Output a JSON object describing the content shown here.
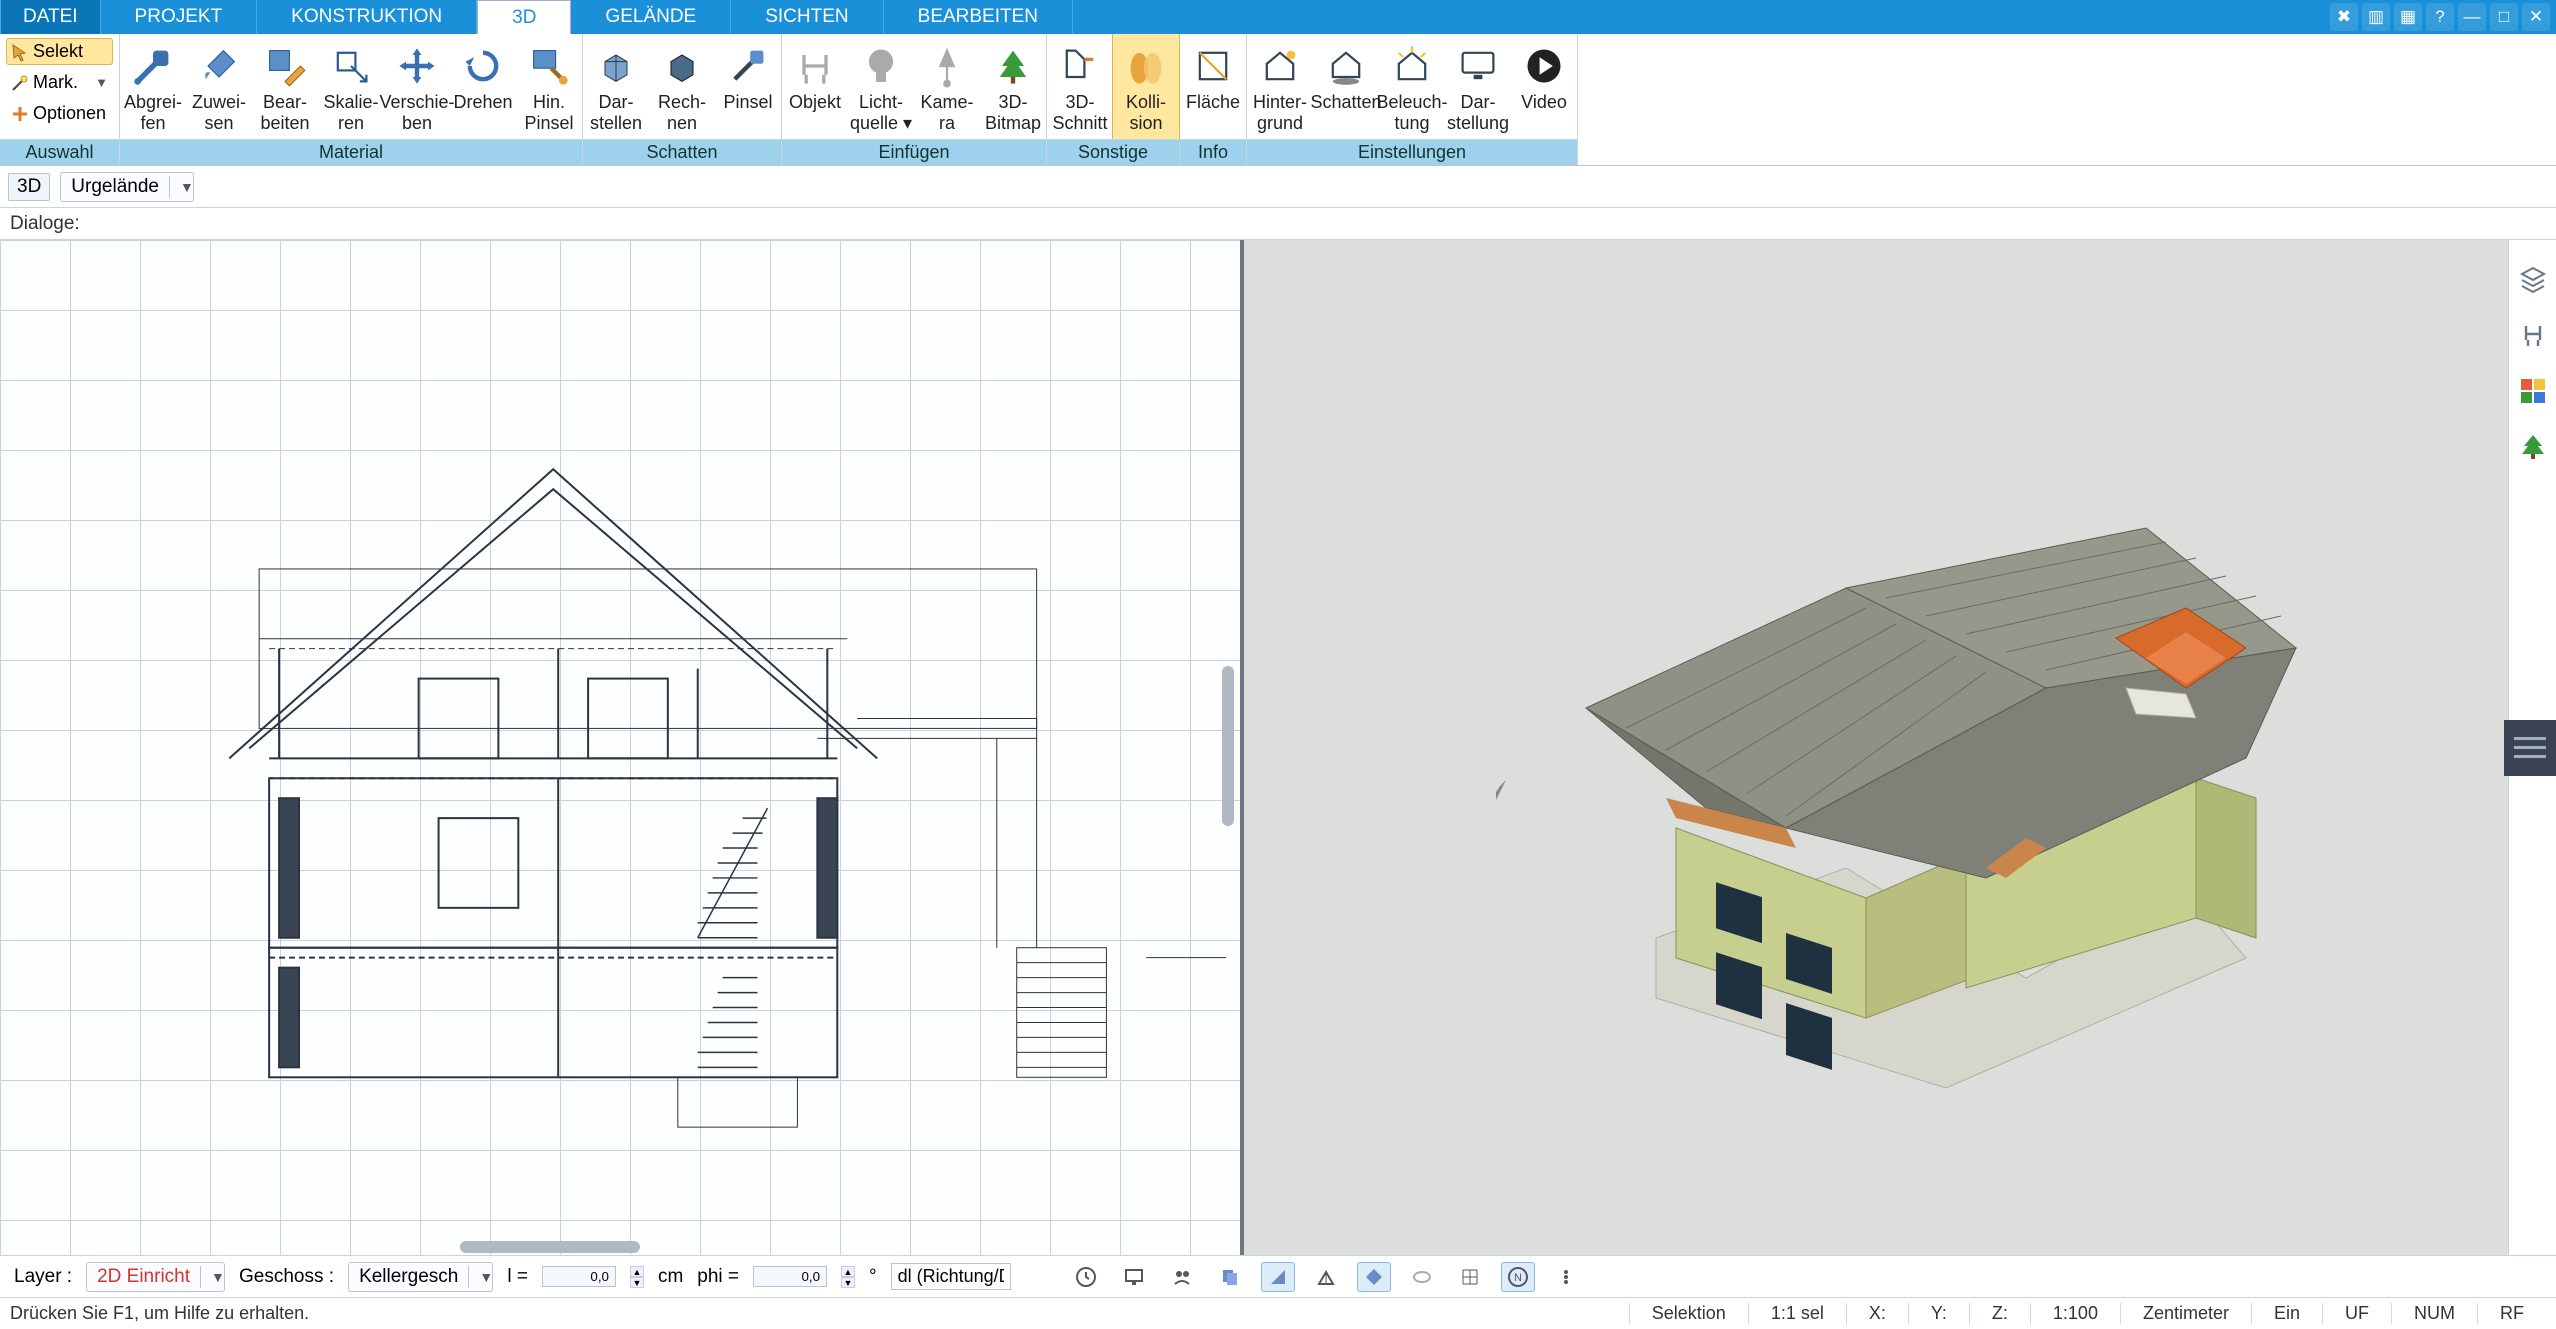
{
  "colors": {
    "primary": "#1a90d8",
    "highlight_bg": "#ffe7a0",
    "highlight_border": "#d7b65a"
  },
  "tabs": {
    "file": "DATEI",
    "items": [
      {
        "label": "PROJEKT"
      },
      {
        "label": "KONSTRUKTION"
      },
      {
        "label": "3D",
        "active": true
      },
      {
        "label": "GELÄNDE"
      },
      {
        "label": "SICHTEN"
      },
      {
        "label": "BEARBEITEN"
      }
    ]
  },
  "sel_group": {
    "label": "Auswahl",
    "select": "Selekt",
    "mark": "Mark.",
    "options": "Optionen"
  },
  "groups": {
    "material": {
      "label": "Material",
      "buttons": [
        {
          "id": "abgreifen",
          "line1": "Abgrei-",
          "line2": "fen"
        },
        {
          "id": "zuweisen",
          "line1": "Zuwei-",
          "line2": "sen"
        },
        {
          "id": "bearbeiten",
          "line1": "Bear-",
          "line2": "beiten"
        },
        {
          "id": "skalieren",
          "line1": "Skalie-",
          "line2": "ren"
        },
        {
          "id": "verschieben",
          "line1": "Verschie-",
          "line2": "ben"
        },
        {
          "id": "drehen",
          "line1": "Drehen",
          "line2": ""
        },
        {
          "id": "hinpinsel",
          "line1": "Hin.",
          "line2": "Pinsel"
        }
      ]
    },
    "schatten": {
      "label": "Schatten",
      "buttons": [
        {
          "id": "darstellen_s",
          "line1": "Dar-",
          "line2": "stellen"
        },
        {
          "id": "rechnen",
          "line1": "Rech-",
          "line2": "nen"
        },
        {
          "id": "pinsel",
          "line1": "Pinsel",
          "line2": ""
        }
      ]
    },
    "einfuegen": {
      "label": "Einfügen",
      "buttons": [
        {
          "id": "objekt",
          "line1": "Objekt",
          "line2": ""
        },
        {
          "id": "lichtquelle",
          "line1": "Licht-",
          "line2": "quelle ▾"
        },
        {
          "id": "kamera",
          "line1": "Kame-",
          "line2": "ra"
        },
        {
          "id": "3dbitmap",
          "line1": "3D-",
          "line2": "Bitmap"
        }
      ]
    },
    "sonstige": {
      "label": "Sonstige",
      "buttons": [
        {
          "id": "3dschnitt",
          "line1": "3D-",
          "line2": "Schnitt"
        },
        {
          "id": "kollision",
          "line1": "Kolli-",
          "line2": "sion",
          "active": true
        }
      ]
    },
    "info": {
      "label": "Info",
      "buttons": [
        {
          "id": "flaeche",
          "line1": "Fläche",
          "line2": ""
        }
      ]
    },
    "einstellungen": {
      "label": "Einstellungen",
      "buttons": [
        {
          "id": "hintergrund",
          "line1": "Hinter-",
          "line2": "grund"
        },
        {
          "id": "schatten",
          "line1": "Schatten",
          "line2": ""
        },
        {
          "id": "beleuchtung",
          "line1": "Beleuch-",
          "line2": "tung"
        },
        {
          "id": "darstellung",
          "line1": "Dar-",
          "line2": "stellung"
        },
        {
          "id": "video",
          "line1": "Video",
          "line2": ""
        }
      ]
    }
  },
  "subbar": {
    "mode": "3D",
    "combo_value": "Urgelände"
  },
  "dialoge_label": "Dialoge:",
  "bottom": {
    "layer_label": "Layer :",
    "layer_value": "2D Einricht",
    "geschoss_label": "Geschoss :",
    "geschoss_value": "Kellergesch",
    "l_label": "l =",
    "l_value": "0,0",
    "l_unit": "cm",
    "phi_label": "phi =",
    "phi_value": "0,0",
    "phi_unit": "°",
    "dl_hint": "dl (Richtung/Di"
  },
  "status": {
    "help": "Drücken Sie F1, um Hilfe zu erhalten.",
    "selection": "Selektion",
    "sel_count": "1:1 sel",
    "x": "X:",
    "y": "Y:",
    "z": "Z:",
    "scale": "1:100",
    "unit": "Zentimeter",
    "ein": "Ein",
    "uf": "UF",
    "num": "NUM",
    "rf": "RF"
  },
  "side_icons": [
    "layers-icon",
    "chair-icon",
    "swatches-icon",
    "tree-icon"
  ],
  "bottom_icons": [
    "clock-icon",
    "screen-icon",
    "group-icon",
    "sheets-icon",
    "tri1-icon",
    "tri2-icon",
    "diamond-icon",
    "disk-icon",
    "grid-icon",
    "compass-icon",
    "more-icon"
  ]
}
